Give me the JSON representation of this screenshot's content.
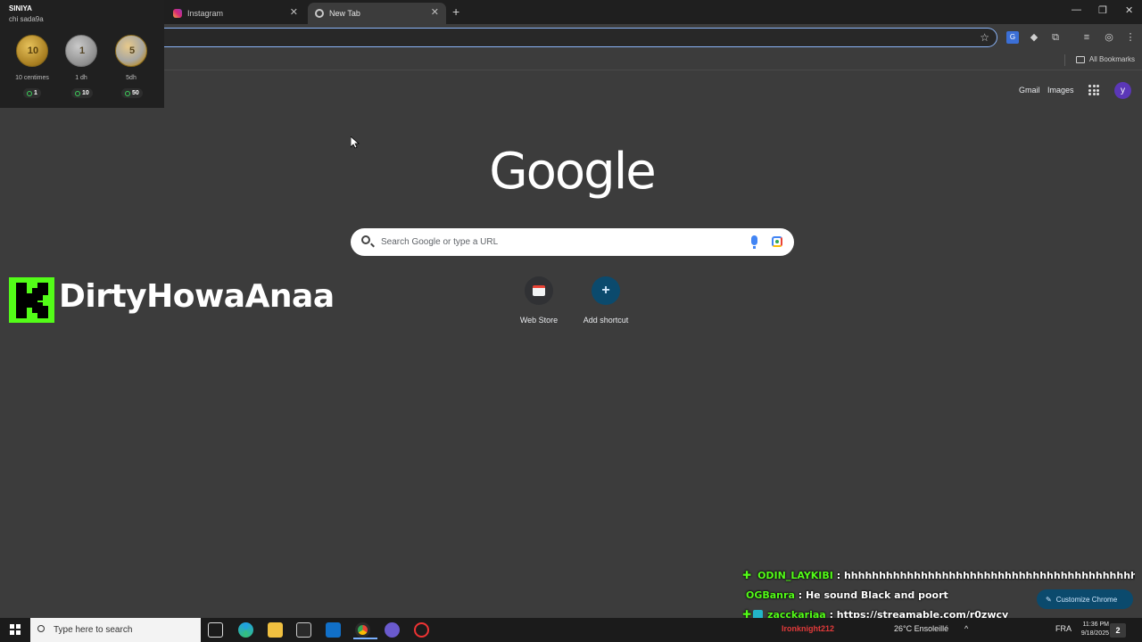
{
  "tabs": [
    {
      "label": "Instagram"
    },
    {
      "label": "New Tab"
    }
  ],
  "bookmarks": {
    "all_label": "All Bookmarks"
  },
  "ntp": {
    "gmail": "Gmail",
    "images": "Images",
    "avatar_letter": "y",
    "logo": "Google",
    "search_placeholder": "Search Google or type a URL",
    "shortcuts": [
      {
        "label": "Web Store"
      },
      {
        "label": "Add shortcut"
      }
    ],
    "customize_label": "Customize Chrome"
  },
  "coin_panel": {
    "title": "SINIYA",
    "subtitle": "chi sada9a",
    "coins": [
      {
        "face": "10",
        "label": "10 centimes",
        "count": "1"
      },
      {
        "face": "1",
        "label": "1 dh",
        "count": "10"
      },
      {
        "face": "5",
        "label": "5dh",
        "count": "50"
      }
    ]
  },
  "stream": {
    "channel_name": "DirtyHowaAnaa"
  },
  "chat": [
    {
      "user": "ODIN_LAYKIBI",
      "message": ": hhhhhhhhhhhhhhhhhhhhhhhhhhhhhhhhhhhhhhhhhh"
    },
    {
      "user": "OGBanra",
      "message": ": He sound Black and poort"
    },
    {
      "user": "zacckariaa",
      "message": ": https://streamable.com/r0zwcy"
    }
  ],
  "taskbar": {
    "search_placeholder": "Type here to search",
    "tray_user": "Ironknight212",
    "weather": "26°C  Ensoleillé",
    "lang": "FRA",
    "time": "11:36 PM",
    "date": "9/18/2025",
    "notif_count": "2"
  },
  "colors": {
    "kick_green": "#53fc18",
    "accent_blue": "#8ab4f8",
    "avatar_purple": "#5b37b7"
  }
}
